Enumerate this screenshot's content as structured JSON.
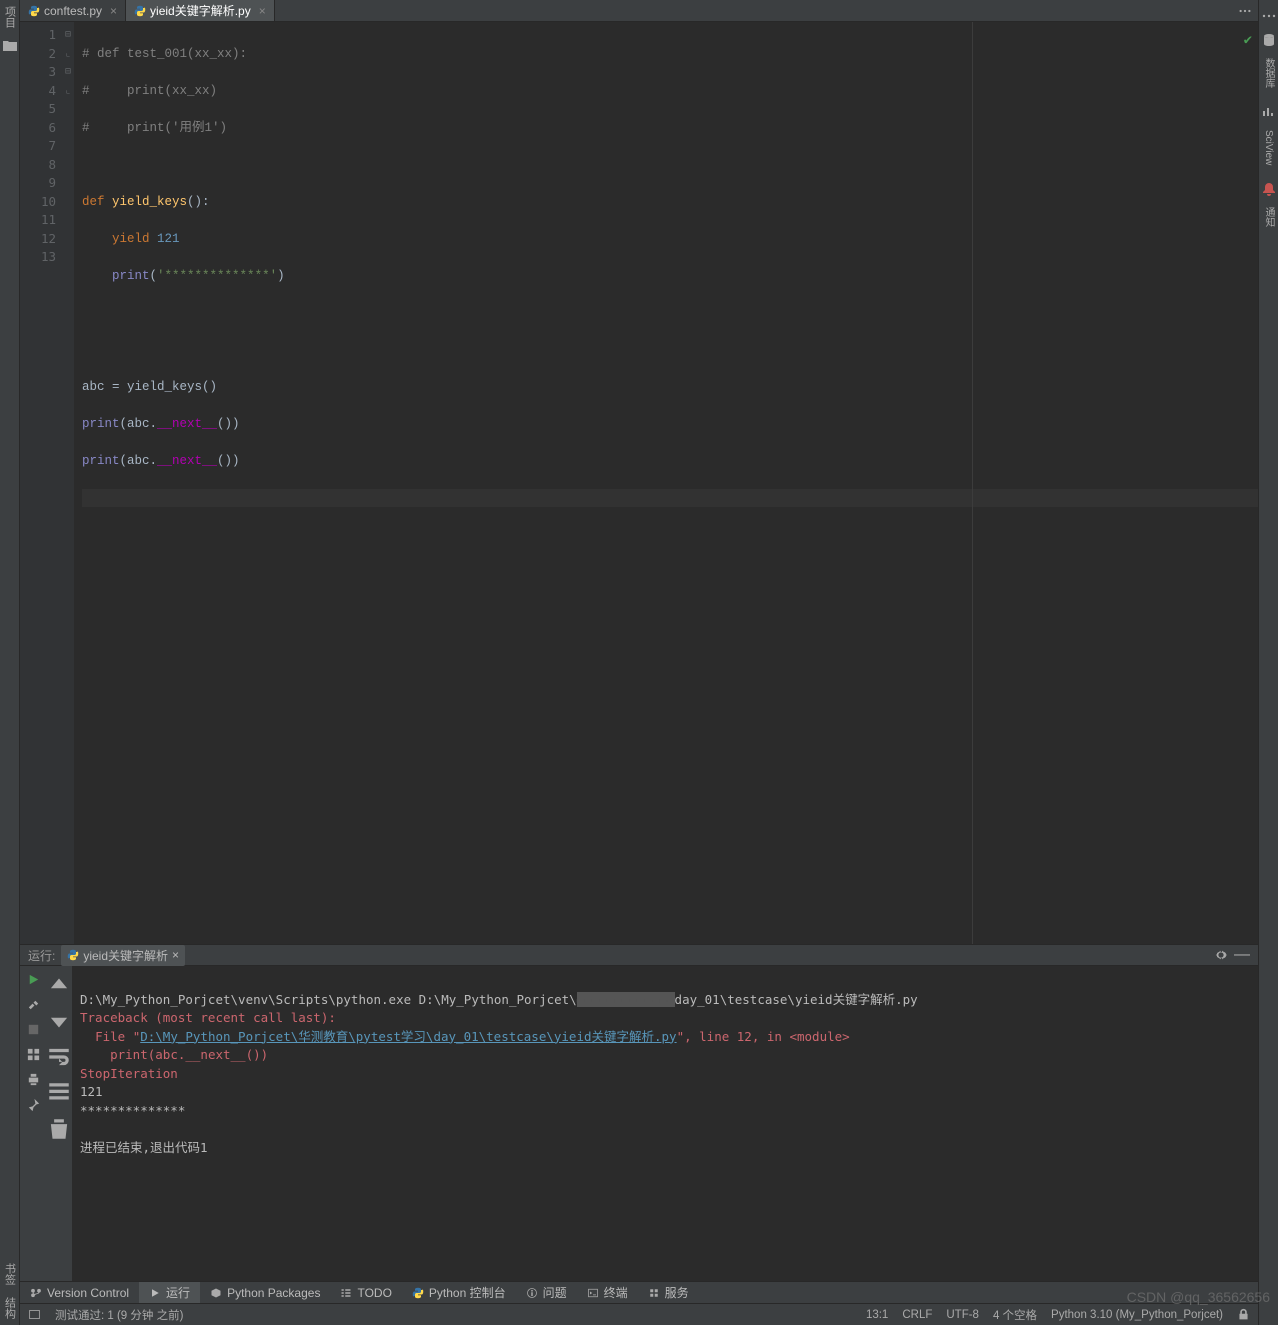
{
  "tabs": [
    {
      "label": "conftest.py",
      "active": false
    },
    {
      "label": "yieid关键字解析.py",
      "active": true
    }
  ],
  "gutter_lines": [
    "1",
    "2",
    "3",
    "4",
    "5",
    "6",
    "7",
    "8",
    "9",
    "10",
    "11",
    "12",
    "13"
  ],
  "code": {
    "l1a": "# def test_001(xx_xx):",
    "l2a": "#     print(xx_xx)",
    "l3a": "#     print('用例1')",
    "l5_def": "def ",
    "l5_fn": "yield_keys",
    "l5_tail": "():",
    "l6_kw": "yield ",
    "l6_num": "121",
    "l7_bi": "print",
    "l7_p": "(",
    "l7_str": "'**************'",
    "l7_pc": ")",
    "l10a": "abc = yield_keys()",
    "l11_bi": "print",
    "l11a": "(abc.",
    "l11_mag": "__next__",
    "l11b": "())",
    "l12_bi": "print",
    "l12a": "(abc.",
    "l12_mag": "__next__",
    "l12b": "())"
  },
  "run": {
    "header_label": "运行:",
    "tab": "yieid关键字解析",
    "line1": "D:\\My_Python_Porjcet\\venv\\Scripts\\python.exe D:\\My_Python_Porjcet\\",
    "line1b": "day_01\\testcase\\yieid关键字解析.py",
    "trace": "Traceback (most recent call last):",
    "file_pre": "  File \"",
    "file_link": "D:\\My_Python_Porjcet\\华测教育\\pytest学习\\day_01\\testcase\\yieid关键字解析.py",
    "file_post": "\", line 12, in <module>",
    "at": "    print(abc.__next__())",
    "exc": "StopIteration",
    "out1": "121",
    "out2": "**************",
    "exit": "进程已结束,退出代码1"
  },
  "bottom_tabs": [
    {
      "icon": "branch",
      "label": "Version Control"
    },
    {
      "icon": "play",
      "label": "运行"
    },
    {
      "icon": "pkg",
      "label": "Python Packages"
    },
    {
      "icon": "todo",
      "label": "TODO"
    },
    {
      "icon": "py",
      "label": "Python 控制台"
    },
    {
      "icon": "info",
      "label": "问题"
    },
    {
      "icon": "term",
      "label": "终端"
    },
    {
      "icon": "svc",
      "label": "服务"
    }
  ],
  "left_bar": {
    "proj": "项目"
  },
  "right_bar": {
    "notif": "通知",
    "sci": "SciView",
    "db": "数据库"
  },
  "status": {
    "tests": "测试通过: 1 (9 分钟 之前)",
    "pos": "13:1",
    "lf": "CRLF",
    "enc": "UTF-8",
    "indent": "4 个空格",
    "interp": "Python 3.10 (My_Python_Porjcet)"
  },
  "watermark": "CSDN @qq_36562656"
}
